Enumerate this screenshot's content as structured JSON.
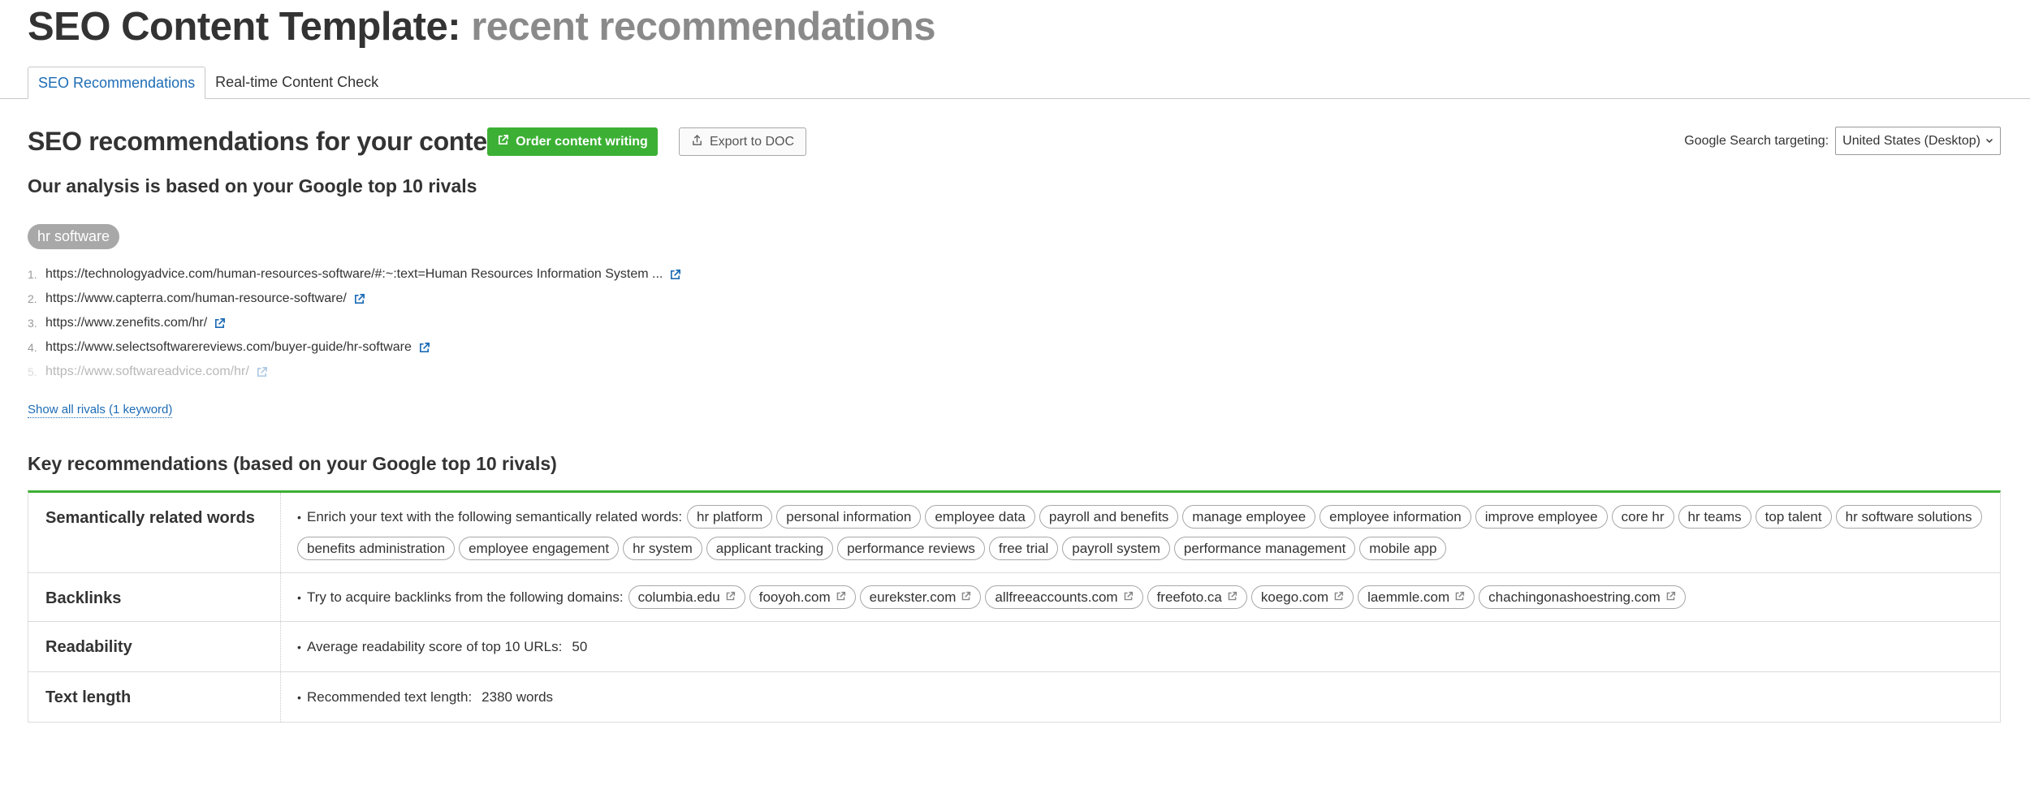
{
  "header": {
    "title_main": "SEO Content Template:",
    "title_sub": "recent recommendations"
  },
  "tabs": [
    {
      "label": "SEO Recommendations",
      "active": true
    },
    {
      "label": "Real-time Content Check",
      "active": false
    }
  ],
  "section": {
    "title": "SEO recommendations for your content",
    "order_button": "Order content writing",
    "export_button": "Export to DOC",
    "targeting_label": "Google Search targeting:",
    "targeting_value": "United States (Desktop)"
  },
  "analysis": {
    "title": "Our analysis is based on your Google top 10 rivals",
    "keyword": "hr software",
    "rivals": [
      {
        "num": "1.",
        "url": "https://technologyadvice.com/human-resources-software/#:~:text=Human Resources Information System ..."
      },
      {
        "num": "2.",
        "url": "https://www.capterra.com/human-resource-software/"
      },
      {
        "num": "3.",
        "url": "https://www.zenefits.com/hr/"
      },
      {
        "num": "4.",
        "url": "https://www.selectsoftwarereviews.com/buyer-guide/hr-software"
      },
      {
        "num": "5.",
        "url": "https://www.softwareadvice.com/hr/"
      }
    ],
    "show_all": "Show all rivals (1 keyword)"
  },
  "key_recommendations": {
    "title": "Key recommendations (based on your Google top 10 rivals)",
    "accent_color": "#3cb034",
    "semantic": {
      "label": "Semantically related words",
      "text": "Enrich your text with the following semantically related words:",
      "words": [
        "hr platform",
        "personal information",
        "employee data",
        "payroll and benefits",
        "manage employee",
        "employee information",
        "improve employee",
        "core hr",
        "hr teams",
        "top talent",
        "hr software solutions",
        "benefits administration",
        "employee engagement",
        "hr system",
        "applicant tracking",
        "performance reviews",
        "free trial",
        "payroll system",
        "performance management",
        "mobile app"
      ]
    },
    "backlinks": {
      "label": "Backlinks",
      "text": "Try to acquire backlinks from the following domains:",
      "domains": [
        "columbia.edu",
        "fooyoh.com",
        "eurekster.com",
        "allfreeaccounts.com",
        "freefoto.ca",
        "koego.com",
        "laemmle.com",
        "chachingonashoestring.com"
      ]
    },
    "readability": {
      "label": "Readability",
      "text": "Average readability score of top 10 URLs:",
      "value": "50"
    },
    "text_length": {
      "label": "Text length",
      "text": "Recommended text length:",
      "value": "2380 words"
    }
  }
}
